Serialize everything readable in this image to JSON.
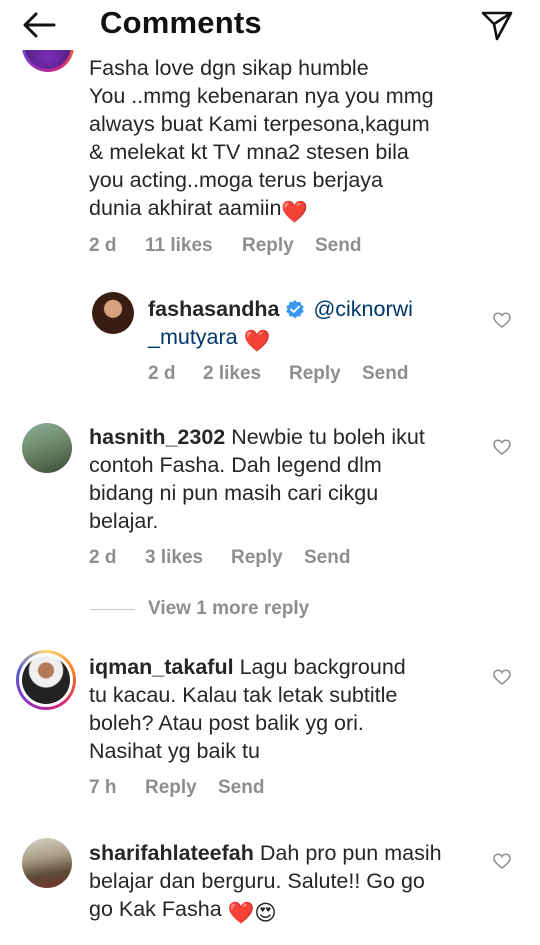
{
  "header": {
    "title": "Comments",
    "back_icon": "arrow-left-icon",
    "send_icon": "paper-plane-icon"
  },
  "comments": [
    {
      "text_lines": [
        "Fasha love dgn sikap humble",
        "You ..mmg kebenaran nya you mmg",
        "always buat Kami terpesona,kagum",
        "& melekat kt TV mna2 stesen bila",
        "you acting..moga terus berjaya",
        "dunia akhirat aamiin"
      ],
      "emoji_end": "❤️",
      "time": "2 d",
      "likes": "11 likes",
      "reply": "Reply",
      "send": "Send"
    },
    {
      "username": "fashasandha",
      "verified": true,
      "mention_line1": "@ciknorwi",
      "mention_line2": "_mutyara",
      "emoji_end": "❤️",
      "time": "2 d",
      "likes": "2 likes",
      "reply": "Reply",
      "send": "Send"
    },
    {
      "username": "hasnith_2302",
      "text_lines": [
        "Newbie tu boleh ikut",
        "contoh Fasha. Dah legend dlm",
        "bidang ni pun masih cari cikgu",
        "belajar."
      ],
      "time": "2 d",
      "likes": "3 likes",
      "reply": "Reply",
      "send": "Send"
    },
    {
      "username": "iqman_takaful",
      "text_lines": [
        "Lagu background",
        "tu kacau. Kalau tak letak subtitle",
        "boleh? Atau post balik yg ori.",
        "Nasihat yg baik tu"
      ],
      "time": "7 h",
      "reply": "Reply",
      "send": "Send"
    },
    {
      "username": "sharifahlateefah",
      "text_lines": [
        "Dah pro pun masih",
        "belajar dan berguru. Salute!! Go go",
        "go Kak Fasha"
      ],
      "emoji_end": "❤️😍"
    }
  ],
  "view_more_replies": "View 1 more reply",
  "icons": {
    "heart": "heart-outline-icon",
    "verified": "verified-badge-icon"
  },
  "colors": {
    "text": "#262626",
    "meta": "#8e8e8e",
    "mention": "#00376b",
    "verified": "#3897f0",
    "heart_emoji": "#ed4956"
  }
}
